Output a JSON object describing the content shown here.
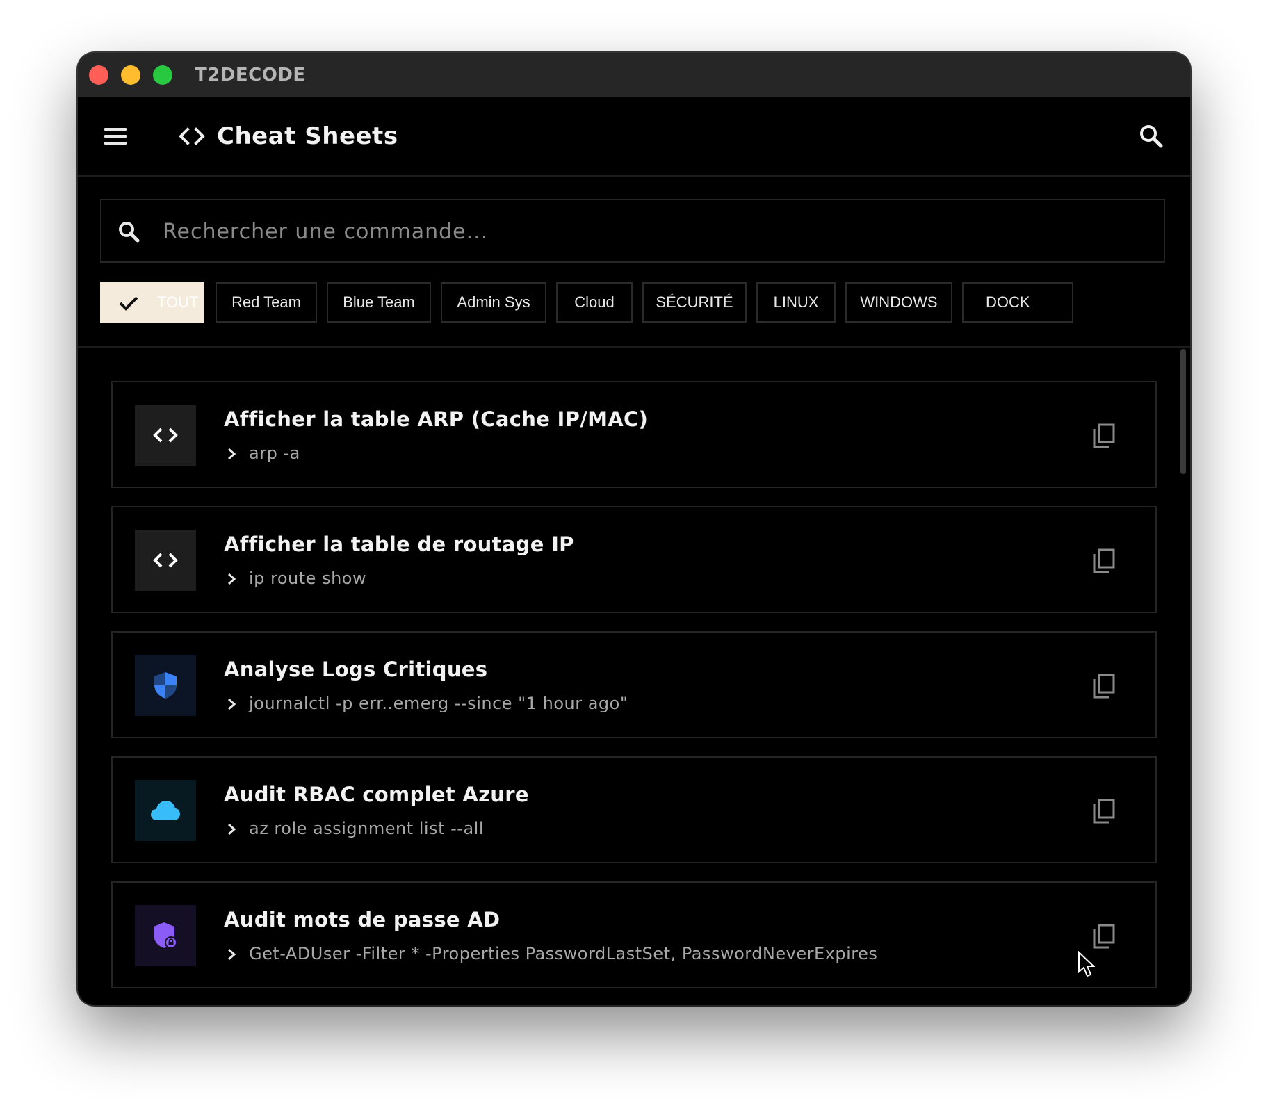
{
  "window": {
    "title": "T2DECODE"
  },
  "header": {
    "title": "Cheat Sheets",
    "menu_icon": "menu-icon",
    "app_icon": "code-icon",
    "search_icon": "search-icon"
  },
  "search": {
    "placeholder": "Rechercher une commande...",
    "value": ""
  },
  "filters": [
    {
      "label": "TOUT",
      "active": true
    },
    {
      "label": "Red Team",
      "active": false
    },
    {
      "label": "Blue Team",
      "active": false
    },
    {
      "label": "Admin Sys",
      "active": false
    },
    {
      "label": "Cloud",
      "active": false
    },
    {
      "label": "SÉCURITÉ",
      "active": false
    },
    {
      "label": "LINUX",
      "active": false
    },
    {
      "label": "WINDOWS",
      "active": false
    },
    {
      "label": "DOCK",
      "active": false
    }
  ],
  "commands": [
    {
      "title": "Afficher la table ARP (Cache IP/MAC)",
      "command": "arp -a",
      "icon": "code-icon",
      "accent": "#ffffff",
      "badge_bg": "#1e1e1e"
    },
    {
      "title": "Afficher la table de routage IP",
      "command": "ip route show",
      "icon": "code-icon",
      "accent": "#ffffff",
      "badge_bg": "#1e1e1e"
    },
    {
      "title": "Analyse Logs Critiques",
      "command": "journalctl -p err..emerg --since \"1 hour ago\"",
      "icon": "shield-icon",
      "accent": "#3b82f6",
      "badge_bg": "#0c1526"
    },
    {
      "title": "Audit RBAC complet Azure",
      "command": "az role assignment list --all",
      "icon": "cloud-icon",
      "accent": "#38bdf8",
      "badge_bg": "#071a22"
    },
    {
      "title": "Audit mots de passe AD",
      "command": "Get-ADUser -Filter * -Properties PasswordLastSet, PasswordNeverExpires",
      "icon": "shield-lock-icon",
      "accent": "#8b5cf6",
      "badge_bg": "#150f26"
    }
  ],
  "colors": {
    "background": "#000000",
    "titlebar": "#262626",
    "active_chip": "#f5ebdc",
    "border": "#242424",
    "muted_text": "#a8a8a8"
  }
}
